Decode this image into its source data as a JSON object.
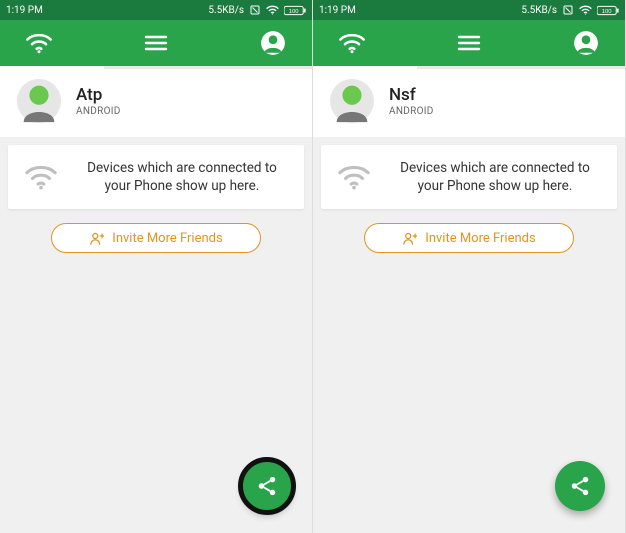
{
  "screens": [
    {
      "status": {
        "time": "1:19 PM",
        "net_speed": "5.5KB/s",
        "battery": "100"
      },
      "user": {
        "name": "Atp",
        "platform": "ANDROID"
      },
      "empty_message": "Devices which are connected to your Phone show up here.",
      "invite_label": "Invite More Friends",
      "active_tab": "wifi",
      "fab_focused": true
    },
    {
      "status": {
        "time": "1:19 PM",
        "net_speed": "5.5KB/s",
        "battery": "100"
      },
      "user": {
        "name": "Nsf",
        "platform": "ANDROID"
      },
      "empty_message": "Devices which are connected to your Phone show up here.",
      "invite_label": "Invite More Friends",
      "active_tab": "wifi",
      "fab_focused": false
    }
  ],
  "colors": {
    "primary": "#2aa44b",
    "primary_dark": "#1b7a3e",
    "accent": "#e1941e"
  }
}
